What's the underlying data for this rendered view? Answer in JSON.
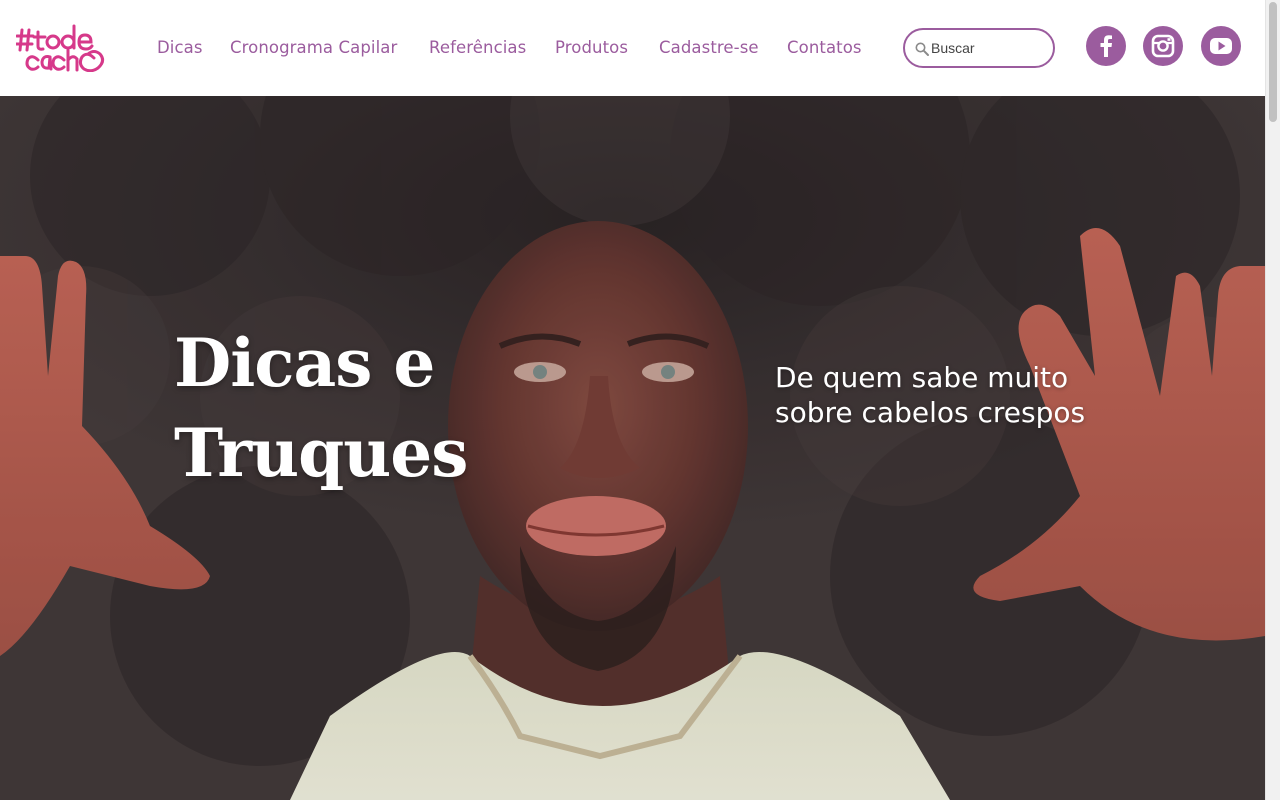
{
  "header": {
    "logo_text": "#to de cacho",
    "nav": [
      {
        "label": "Dicas"
      },
      {
        "label": "Cronograma Capilar"
      },
      {
        "label": "Referências"
      },
      {
        "label": "Produtos"
      },
      {
        "label": "Cadastre-se"
      },
      {
        "label": "Contatos"
      }
    ],
    "search": {
      "placeholder": "Buscar",
      "value": ""
    },
    "social": [
      {
        "icon": "facebook-icon"
      },
      {
        "icon": "instagram-icon"
      },
      {
        "icon": "youtube-icon"
      }
    ]
  },
  "hero": {
    "title": "Dicas e Truques",
    "subtitle": "De quem sabe muito sobre cabelos crespos"
  },
  "colors": {
    "brand_pink": "#d6398a",
    "nav_purple": "#9b5c9e",
    "hero_text": "#ffffff"
  }
}
